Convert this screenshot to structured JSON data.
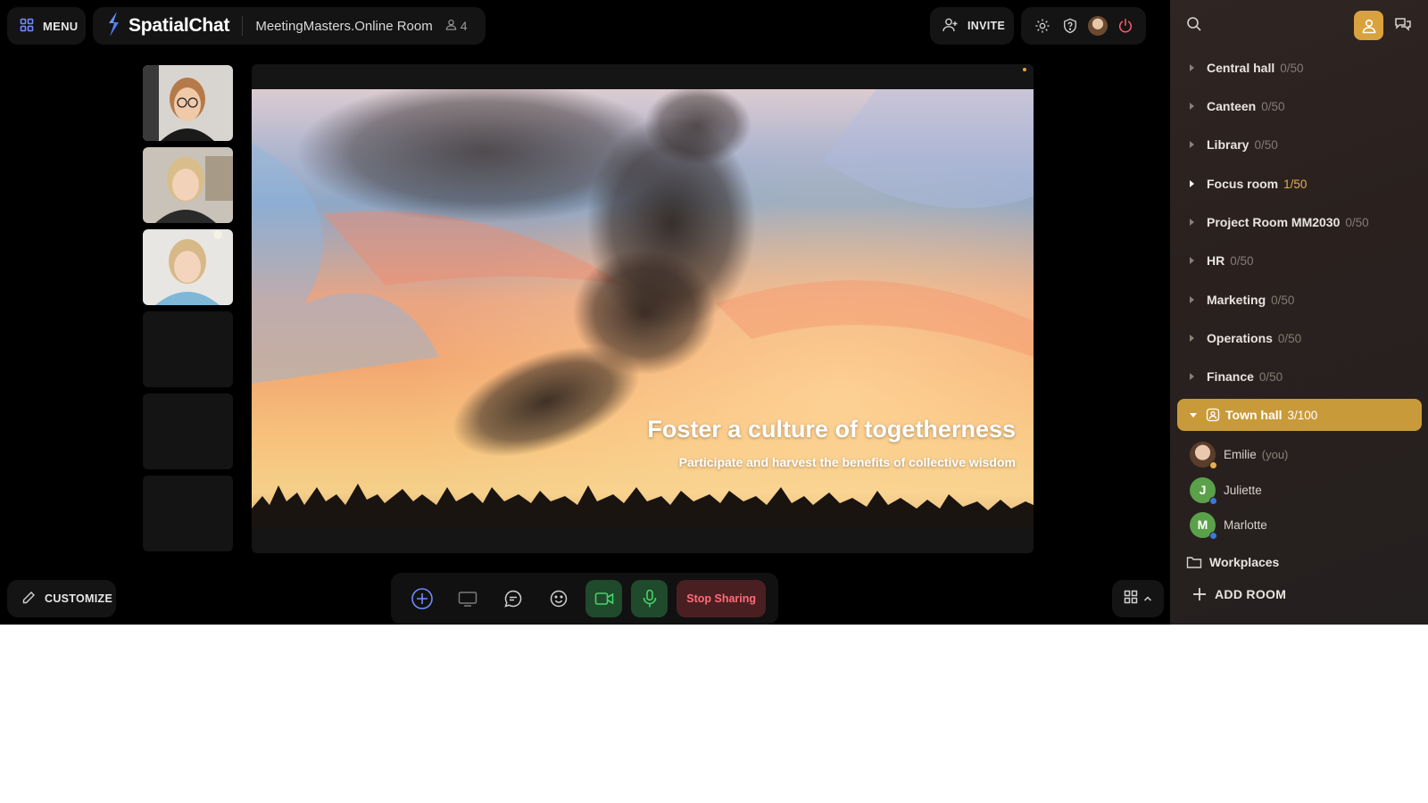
{
  "topbar": {
    "menu_label": "MENU",
    "brand_name": "SpatialChat",
    "room_name": "MeetingMasters.Online Room",
    "user_count": "4",
    "invite_label": "INVITE"
  },
  "slide": {
    "title": "Foster a culture of togetherness",
    "subtitle": "Participate and harvest the benefits of collective wisdom"
  },
  "bottom": {
    "customize_label": "CUSTOMIZE",
    "stop_sharing_label": "Stop Sharing"
  },
  "sidebar": {
    "rooms": [
      {
        "name": "Central hall",
        "count": "0/50"
      },
      {
        "name": "Canteen",
        "count": "0/50"
      },
      {
        "name": "Library",
        "count": "0/50"
      },
      {
        "name": "Focus room",
        "count": "1/50"
      },
      {
        "name": "Project Room MM2030",
        "count": "0/50"
      },
      {
        "name": "HR",
        "count": "0/50"
      },
      {
        "name": "Marketing",
        "count": "0/50"
      },
      {
        "name": "Operations",
        "count": "0/50"
      },
      {
        "name": "Finance",
        "count": "0/50"
      }
    ],
    "active_room": {
      "name": "Town hall",
      "count": "3/100"
    },
    "participants": [
      {
        "name": "Emilie",
        "suffix": "(you)",
        "initial": ""
      },
      {
        "name": "Juliette",
        "suffix": "",
        "initial": "J"
      },
      {
        "name": "Marlotte",
        "suffix": "",
        "initial": "M"
      }
    ],
    "workplaces_label": "Workplaces",
    "add_room_label": "ADD ROOM"
  },
  "colors": {
    "accent": "#c99a3a",
    "stop_sharing_text": "#ff6b78",
    "green_button": "#1f4a2b",
    "sidebar_bg": "#2a211f"
  },
  "icons": [
    "grid-icon",
    "spatialchat-logo-icon",
    "user-icon",
    "add-user-icon",
    "gear-icon",
    "help-icon",
    "power-icon",
    "search-icon",
    "profile-icon",
    "chat-icon",
    "add-icon",
    "screen-share-icon",
    "message-icon",
    "emoji-icon",
    "video-camera-icon",
    "microphone-icon",
    "layout-grid-icon",
    "chevron-up-icon",
    "pencil-icon",
    "folder-icon",
    "plus-icon"
  ]
}
